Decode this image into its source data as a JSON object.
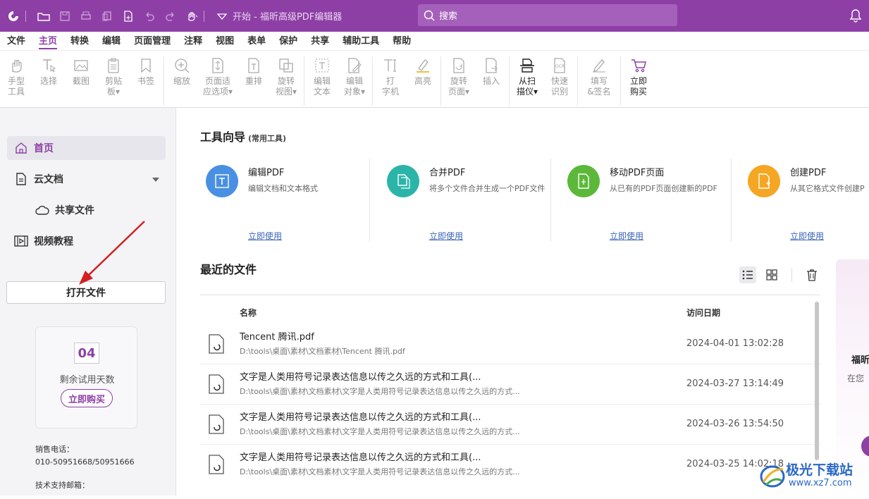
{
  "app": {
    "title": "开始 - 福昕高级PDF编辑器",
    "accent": "#8e3fa6"
  },
  "search": {
    "label": "搜索"
  },
  "menu": [
    "文件",
    "主页",
    "转换",
    "编辑",
    "页面管理",
    "注释",
    "视图",
    "表单",
    "保护",
    "共享",
    "辅助工具",
    "帮助"
  ],
  "menu_active": "主页",
  "ribbon": {
    "hand": "手型\n工具",
    "select": "选择",
    "screenshot": "截图",
    "clipboard": "剪贴\n板▾",
    "bookmark": "书签",
    "zoom": "缩放",
    "fit_page": "页面适\n应选项▾",
    "reflow": "重排",
    "rotate_view": "旋转\n视图▾",
    "edit_text": "编辑\n文本",
    "edit_object": "编辑\n对象▾",
    "typewriter": "打\n字机",
    "highlight": "高亮",
    "rotate_page": "旋转\n页面▾",
    "insert": "插入",
    "from_scanner": "从扫\n描仪▾",
    "quick_ocr": "快速\n识别",
    "fill_sign": "填写\n&签名",
    "buy_now": "立即\n购买"
  },
  "sidebar": {
    "home": "首页",
    "cloud_docs": "云文档",
    "shared_files": "共享文件",
    "video_tutorial": "视频教程",
    "open_file": "打开文件",
    "trial_days": "04",
    "trial_label": "剩余试用天数",
    "buy_button": "立即购买",
    "sales_label": "销售电话：",
    "sales_phone": "010-50951668/50951666",
    "support_label": "技术支持邮箱："
  },
  "tool_guide": {
    "title": "工具向导",
    "subtitle": "(常用工具)",
    "cards": [
      {
        "name": "编辑PDF",
        "desc": "编辑文档和文本格式",
        "link": "立即使用",
        "color": "#4a90e2"
      },
      {
        "name": "合并PDF",
        "desc": "将多个文件合并生成一个PDF文件",
        "link": "立即使用",
        "color": "#2bb5a8"
      },
      {
        "name": "移动PDF页面",
        "desc": "从已有的PDF页面创建新的PDF",
        "link": "立即使用",
        "color": "#5cb83a"
      },
      {
        "name": "创建PDF",
        "desc": "从其它格式文件创建P",
        "link": "立即使用",
        "color": "#f5a623"
      }
    ]
  },
  "recent": {
    "title": "最近的文件",
    "col_name": "名称",
    "col_date": "访问日期",
    "rows": [
      {
        "name": "Tencent 腾讯.pdf",
        "path": "D:\\tools\\桌面\\素材\\文档素材\\Tencent 腾讯.pdf",
        "date": "2024-04-01 13:02:28"
      },
      {
        "name": "文字是人类用符号记录表达信息以传之久远的方式和工具(...",
        "path": "D:\\tools\\桌面\\素材\\文档素材\\文字是人类用符号记录表达信息以传之久远的方式...",
        "date": "2024-03-27 13:14:49"
      },
      {
        "name": "文字是人类用符号记录表达信息以传之久远的方式和工具(...",
        "path": "D:\\tools\\桌面\\素材\\文档素材\\文字是人类用符号记录表达信息以传之久远的方式...",
        "date": "2024-03-26 13:54:50"
      },
      {
        "name": "文字是人类用符号记录表达信息以传之久远的方式和工具(...",
        "path": "D:\\tools\\桌面\\素材\\文档素材\\文字是人类用符号记录表达信息以传之久远的方式...",
        "date": "2024-03-25 14:02:18"
      }
    ]
  },
  "promo": {
    "line1": "福昕",
    "line2": "在您"
  },
  "watermark": {
    "line1": "极光下载站",
    "line2": "www.xz7.com"
  }
}
